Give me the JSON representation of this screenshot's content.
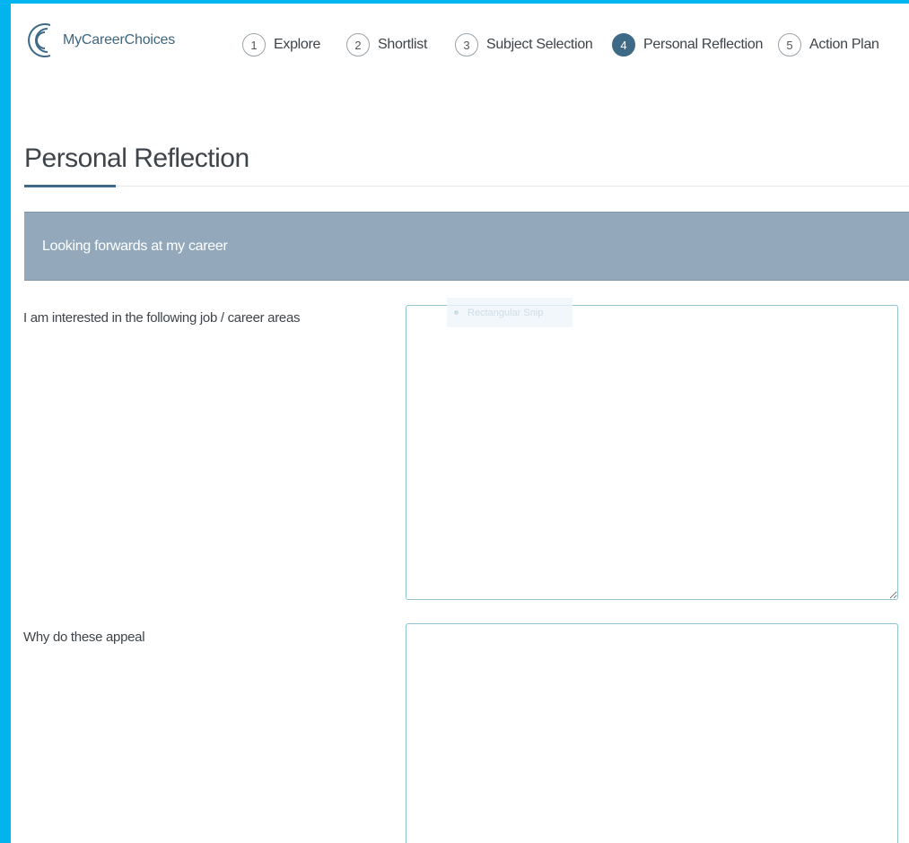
{
  "brand": {
    "name": "MyCareerChoices",
    "color": "#3f6a87"
  },
  "steps": [
    {
      "num": "1",
      "label": "Explore",
      "active": false
    },
    {
      "num": "2",
      "label": "Shortlist",
      "active": false
    },
    {
      "num": "3",
      "label": "Subject Selection",
      "active": false
    },
    {
      "num": "4",
      "label": "Personal Reflection",
      "active": true
    },
    {
      "num": "5",
      "label": "Action Plan",
      "active": false
    }
  ],
  "page": {
    "title": "Personal Reflection"
  },
  "section": {
    "title": "Looking forwards at my career"
  },
  "questions": [
    {
      "label": "I am interested in the following job / career areas",
      "value": ""
    },
    {
      "label": "Why do these appeal",
      "value": ""
    }
  ],
  "ghost_chip": {
    "text": "Rectangular Snip"
  },
  "colors": {
    "page_border": "#00b4f0",
    "section_bar": "#93a9bb",
    "active_step": "#3f6a87"
  }
}
